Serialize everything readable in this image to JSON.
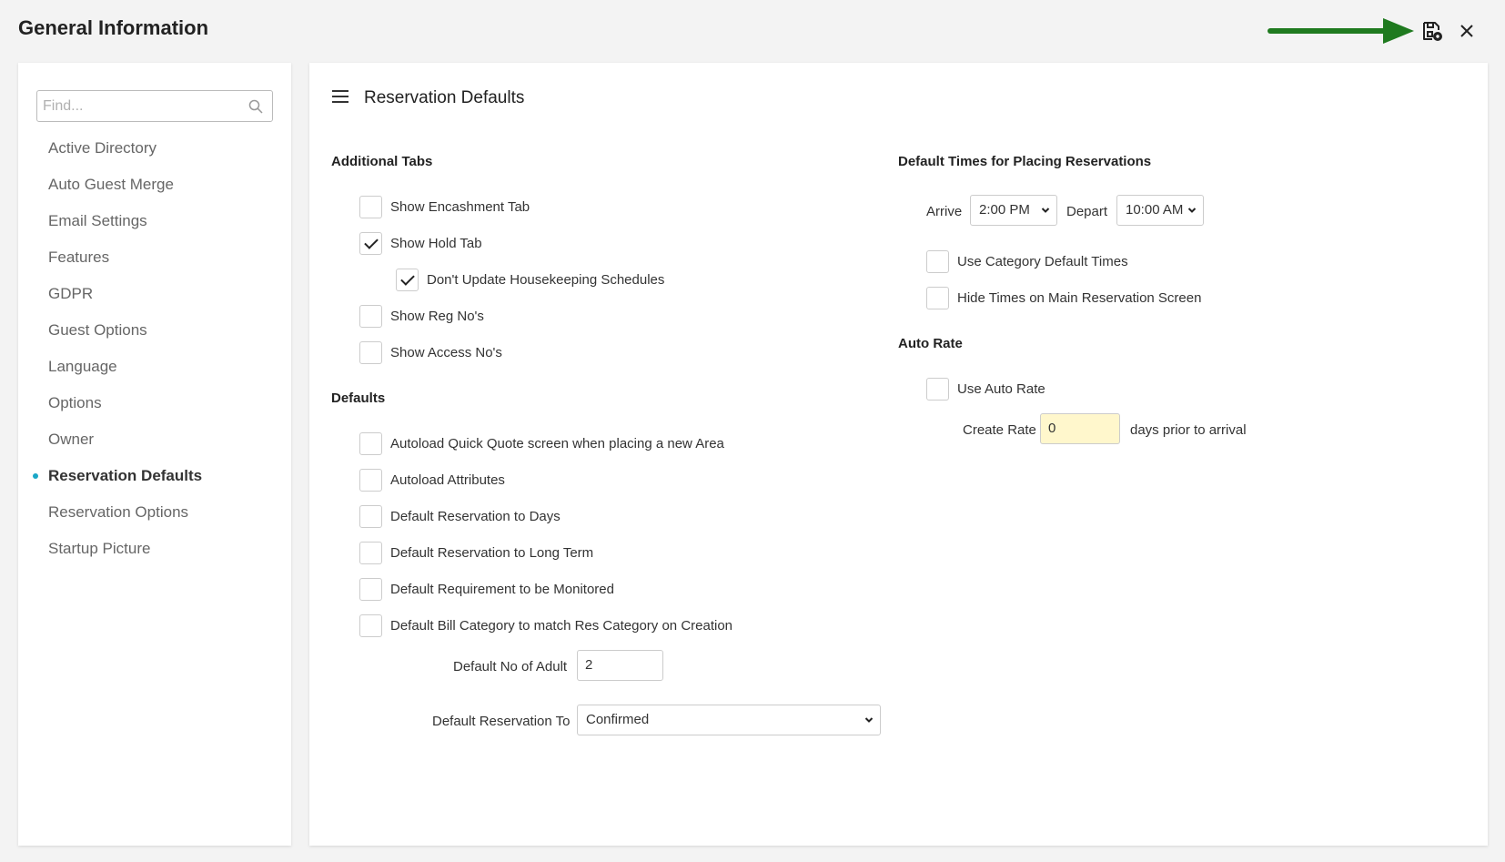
{
  "header": {
    "title": "General Information",
    "arrow_color": "#1f7a1f"
  },
  "sidebar": {
    "search_placeholder": "Find...",
    "accent_color": "#1aa7c7",
    "items": [
      {
        "label": "Active Directory"
      },
      {
        "label": "Auto Guest Merge"
      },
      {
        "label": "Email Settings"
      },
      {
        "label": "Features"
      },
      {
        "label": "GDPR"
      },
      {
        "label": "Guest Options"
      },
      {
        "label": "Language"
      },
      {
        "label": "Options"
      },
      {
        "label": "Owner"
      },
      {
        "label": "Reservation Defaults",
        "active": true
      },
      {
        "label": "Reservation Options"
      },
      {
        "label": "Startup Picture"
      }
    ]
  },
  "main": {
    "title": "Reservation Defaults",
    "additional_tabs": {
      "title": "Additional Tabs",
      "items": [
        {
          "label": "Show Encashment Tab",
          "checked": false
        },
        {
          "label": "Show Hold Tab",
          "checked": true
        },
        {
          "label": "Don't Update Housekeeping Schedules",
          "checked": true
        },
        {
          "label": "Show Reg No's",
          "checked": false
        },
        {
          "label": "Show Access No's",
          "checked": false
        }
      ]
    },
    "defaults": {
      "title": "Defaults",
      "items": [
        {
          "label": "Autoload Quick Quote screen when placing a new Area",
          "checked": false
        },
        {
          "label": "Autoload Attributes",
          "checked": false
        },
        {
          "label": "Default Reservation to Days",
          "checked": false
        },
        {
          "label": "Default Reservation to Long Term",
          "checked": false
        },
        {
          "label": "Default Requirement to be Monitored",
          "checked": false
        },
        {
          "label": "Default Bill Category to match Res Category on Creation",
          "checked": false
        }
      ],
      "adult_label": "Default No of Adult",
      "adult_value": "2",
      "res_to_label": "Default Reservation To",
      "res_to_value": "Confirmed"
    },
    "default_times": {
      "title": "Default Times for Placing Reservations",
      "arrive_label": "Arrive",
      "arrive_value": "2:00 PM",
      "depart_label": "Depart",
      "depart_value": "10:00 AM",
      "items": [
        {
          "label": "Use Category Default Times",
          "checked": false
        },
        {
          "label": "Hide Times on Main Reservation Screen",
          "checked": false
        }
      ]
    },
    "auto_rate": {
      "title": "Auto Rate",
      "use_label": "Use Auto Rate",
      "use_checked": false,
      "create_rate_label": "Create Rate",
      "create_rate_value": "0",
      "suffix": "days prior to arrival"
    }
  }
}
